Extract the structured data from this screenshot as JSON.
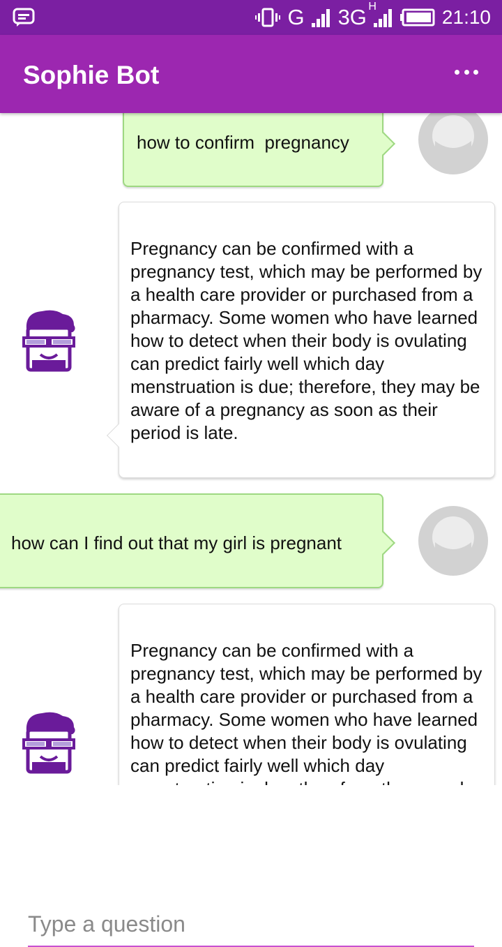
{
  "status_bar": {
    "network_g": "G",
    "network_3g": "3G",
    "network_h": "H",
    "time": "21:10"
  },
  "app_bar": {
    "title": "Sophie Bot",
    "menu_icon": "overflow-menu-icon"
  },
  "messages": [
    {
      "sender": "user",
      "text": "how to confirm  pregnancy"
    },
    {
      "sender": "bot",
      "text": "Pregnancy can be confirmed with a pregnancy test, which may be performed by a health care provider or purchased from a pharmacy. Some women who have learned how to detect when their body is ovulating can predict fairly well which day menstruation is due; therefore, they may be aware of a pregnancy as soon as their period is late."
    },
    {
      "sender": "user",
      "text": "how can I find out that my girl is pregnant"
    },
    {
      "sender": "bot",
      "text": "Pregnancy can be confirmed with a pregnancy test, which may be performed by a health care provider or purchased from a pharmacy. Some women who have learned how to detect when their body is ovulating can predict fairly well which day menstruation is due; therefore, they may be aware of a pregnancy as soon as their period is late."
    }
  ],
  "input": {
    "placeholder": "Type a question"
  },
  "colors": {
    "status_bar": "#7b1fa2",
    "app_bar": "#9c27b0",
    "user_bubble": "#e0fdca",
    "user_bubble_border": "#9ed882",
    "input_underline": "#c850d0",
    "bot_avatar": "#6a1b9a"
  }
}
